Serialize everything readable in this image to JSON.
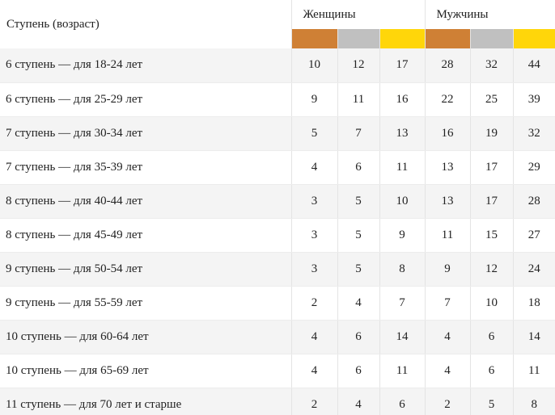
{
  "table": {
    "header_step": "Ступень (возраст)",
    "group_women": "Женщины",
    "group_men": "Мужчины",
    "badge_colors": [
      "#cf8035",
      "#c0c0c0",
      "#ffd60a",
      "#cf8035",
      "#c0c0c0",
      "#ffd60a"
    ],
    "rows": [
      {
        "label": "6 ступень — для 18-24 лет",
        "w_bronze": "10",
        "w_silver": "12",
        "w_gold": "17",
        "m_bronze": "28",
        "m_silver": "32",
        "m_gold": "44"
      },
      {
        "label": "6 ступень — для 25-29 лет",
        "w_bronze": "9",
        "w_silver": "11",
        "w_gold": "16",
        "m_bronze": "22",
        "m_silver": "25",
        "m_gold": "39"
      },
      {
        "label": "7 ступень — для 30-34 лет",
        "w_bronze": "5",
        "w_silver": "7",
        "w_gold": "13",
        "m_bronze": "16",
        "m_silver": "19",
        "m_gold": "32"
      },
      {
        "label": "7 ступень — для 35-39 лет",
        "w_bronze": "4",
        "w_silver": "6",
        "w_gold": "11",
        "m_bronze": "13",
        "m_silver": "17",
        "m_gold": "29"
      },
      {
        "label": "8 ступень — для 40-44 лет",
        "w_bronze": "3",
        "w_silver": "5",
        "w_gold": "10",
        "m_bronze": "13",
        "m_silver": "17",
        "m_gold": "28"
      },
      {
        "label": "8 ступень — для 45-49 лет",
        "w_bronze": "3",
        "w_silver": "5",
        "w_gold": "9",
        "m_bronze": "11",
        "m_silver": "15",
        "m_gold": "27"
      },
      {
        "label": "9 ступень — для 50-54 лет",
        "w_bronze": "3",
        "w_silver": "5",
        "w_gold": "8",
        "m_bronze": "9",
        "m_silver": "12",
        "m_gold": "24"
      },
      {
        "label": "9 ступень — для 55-59 лет",
        "w_bronze": "2",
        "w_silver": "4",
        "w_gold": "7",
        "m_bronze": "7",
        "m_silver": "10",
        "m_gold": "18"
      },
      {
        "label": "10 ступень — для 60-64 лет",
        "w_bronze": "4",
        "w_silver": "6",
        "w_gold": "14",
        "m_bronze": "4",
        "m_silver": "6",
        "m_gold": "14"
      },
      {
        "label": "10 ступень — для 65-69 лет",
        "w_bronze": "4",
        "w_silver": "6",
        "w_gold": "11",
        "m_bronze": "4",
        "m_silver": "6",
        "m_gold": "11"
      },
      {
        "label": "11 ступень — для 70 лет и старше",
        "w_bronze": "2",
        "w_silver": "4",
        "w_gold": "6",
        "m_bronze": "2",
        "m_silver": "5",
        "m_gold": "8"
      }
    ]
  }
}
